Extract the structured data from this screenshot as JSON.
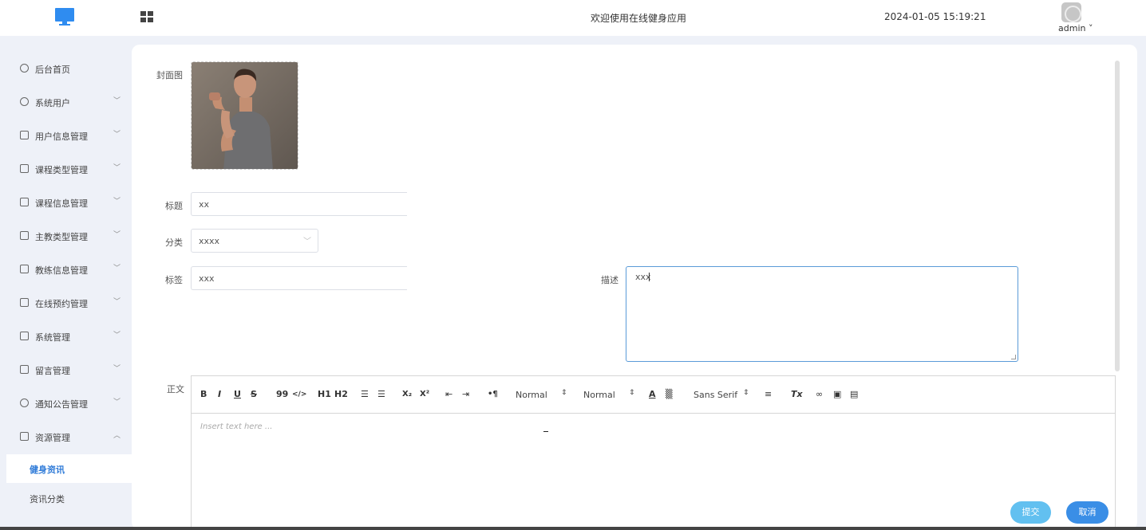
{
  "header": {
    "welcome": "欢迎使用在线健身应用",
    "datetime": "2024-01-05 15:19:21",
    "user": "admin ˅"
  },
  "sidebar": {
    "items": [
      {
        "label": "后台首页",
        "icon": "dashboard-icon",
        "expandable": false
      },
      {
        "label": "系统用户",
        "icon": "user-icon",
        "expandable": true
      },
      {
        "label": "用户信息管理",
        "icon": "list-icon",
        "expandable": true
      },
      {
        "label": "课程类型管理",
        "icon": "list-icon",
        "expandable": true
      },
      {
        "label": "课程信息管理",
        "icon": "list-icon",
        "expandable": true
      },
      {
        "label": "主教类型管理",
        "icon": "list-icon",
        "expandable": true
      },
      {
        "label": "教练信息管理",
        "icon": "list-icon",
        "expandable": true
      },
      {
        "label": "在线预约管理",
        "icon": "calendar-icon",
        "expandable": true
      },
      {
        "label": "系统管理",
        "icon": "check-box-icon",
        "expandable": true
      },
      {
        "label": "留言管理",
        "icon": "message-icon",
        "expandable": true
      },
      {
        "label": "通知公告管理",
        "icon": "megaphone-icon",
        "expandable": true
      },
      {
        "label": "资源管理",
        "icon": "folder-icon",
        "expandable": true,
        "expanded": true
      }
    ],
    "sub_items": [
      {
        "label": "健身资讯",
        "active": true
      },
      {
        "label": "资讯分类",
        "active": false
      }
    ]
  },
  "form": {
    "cover_label": "封面图",
    "title_label": "标题",
    "title_value": "xx",
    "category_label": "分类",
    "category_value": "xxxx",
    "tags_label": "标签",
    "tags_value": "xxx",
    "description_label": "描述",
    "description_value": "xxx",
    "body_label": "正文",
    "editor_placeholder": "Insert text here ...",
    "submit_label": "提交",
    "cancel_label": "取消"
  },
  "editor_toolbar": {
    "bold": "B",
    "italic": "I",
    "underline": "U",
    "strike": "S",
    "blockquote": "99",
    "code": "</>",
    "h1": "H1",
    "h2": "H2",
    "subscript": "X₂",
    "superscript": "X²",
    "direction": "•¶",
    "size_picker": "Normal",
    "header_picker": "Normal",
    "font_picker": "Sans Serif",
    "clean": "Tx"
  },
  "colors": {
    "accent": "#2f8cf0",
    "submit": "#62c0f0",
    "cancel": "#3a8ee6",
    "active_text": "#2f7bd8"
  }
}
